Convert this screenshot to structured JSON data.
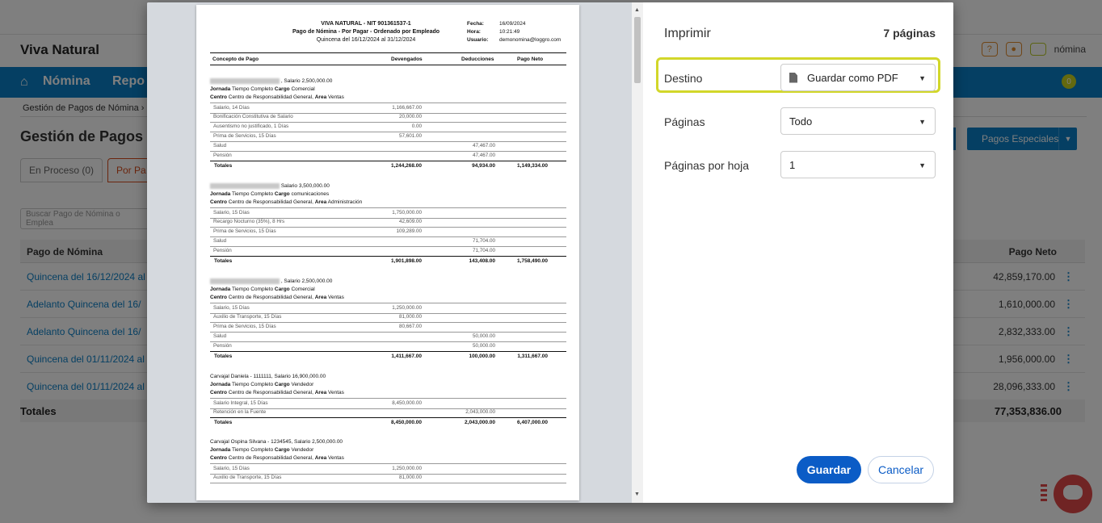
{
  "app": {
    "title": "Viva Natural",
    "user_label": "nómina",
    "help_icon_text": "?",
    "nav": [
      "Nómina",
      "Repo"
    ],
    "nav_badge": "0",
    "breadcrumb": "Gestión de Pagos de Nómina  ›",
    "page_title": "Gestión de Pagos",
    "tabs": [
      "En Proceso (0)",
      "Por Pa"
    ],
    "special_button": "Pagos Especiales",
    "search_placeholder": "Buscar Pago de Nómina o Emplea",
    "table": {
      "col_left": "Pago de Nómina",
      "col_right": "Pago Neto",
      "rows": [
        {
          "name": "Quincena del 16/12/2024 al",
          "amount": "42,859,170.00"
        },
        {
          "name": "Adelanto Quincena del 16/",
          "amount": "1,610,000.00"
        },
        {
          "name": "Adelanto Quincena del 16/",
          "amount": "2,832,333.00"
        },
        {
          "name": "Quincena del 01/11/2024 al",
          "amount": "1,956,000.00"
        },
        {
          "name": "Quincena del 01/11/2024 al",
          "amount": "28,096,333.00"
        }
      ],
      "totals_label": "Totales",
      "totals_amount": "77,353,836.00"
    }
  },
  "dialog": {
    "title": "Imprimir",
    "page_count": "7 páginas",
    "destination_label": "Destino",
    "destination_value": "Guardar como PDF",
    "pages_label": "Páginas",
    "pages_value": "Todo",
    "per_sheet_label": "Páginas por hoja",
    "per_sheet_value": "1",
    "print_button": "Imprimir",
    "print_button_label": "Guardar",
    "cancel_button": "Cancelar",
    "highlight_color": "#d2d72a",
    "accent_color": "#0b5cc6"
  },
  "report": {
    "title1": "VIVA NATURAL - NIT 901361537-1",
    "title2": "Pago de Nómina - Por Pagar - Ordenado por Empleado",
    "title3": "Quincena del 16/12/2024 al 31/12/2024",
    "meta": [
      {
        "label": "Fecha:",
        "value": "16/09/2024"
      },
      {
        "label": "Hora:",
        "value": "10:21:49"
      },
      {
        "label": "Usuario:",
        "value": "demonomina@loggro.com"
      }
    ],
    "columns": [
      "Concepto de Pago",
      "Devengados",
      "Deducciones",
      "Pago Neto"
    ],
    "employees": [
      {
        "head": ", Salario 2,500,000.00",
        "jornada": "Tiempo Completo",
        "cargo": "Comercial",
        "centro": "Centro de Responsabilidad General,",
        "area": "Ventas",
        "lines": [
          {
            "d": "Salario, 14 Días",
            "dev": "1,166,667.00",
            "ded": ""
          },
          {
            "d": "Bonificación Constitutiva de Salario",
            "dev": "20,000.00",
            "ded": ""
          },
          {
            "d": "Ausentismo no justificado, 1 Días",
            "dev": "0.00",
            "ded": ""
          },
          {
            "d": "Prima de Servicios, 15 Días",
            "dev": "57,601.00",
            "ded": ""
          },
          {
            "d": "Salud",
            "dev": "",
            "ded": "47,467.00"
          },
          {
            "d": "Pensión",
            "dev": "",
            "ded": "47,467.00"
          }
        ],
        "tot": {
          "dev": "1,244,268.00",
          "ded": "94,934.00",
          "neto": "1,149,334.00"
        }
      },
      {
        "head": "Salario 3,500,000.00",
        "jornada": "Tiempo Completo",
        "cargo": "comunicaciones",
        "centro": "Centro de Responsabilidad General,",
        "area": "Administración",
        "lines": [
          {
            "d": "Salario, 15 Días",
            "dev": "1,750,000.00",
            "ded": ""
          },
          {
            "d": "Recargo Nocturno (35%), 8 Hrs",
            "dev": "42,609.00",
            "ded": ""
          },
          {
            "d": "Prima de Servicios, 15 Días",
            "dev": "109,289.00",
            "ded": ""
          },
          {
            "d": "Salud",
            "dev": "",
            "ded": "71,704.00"
          },
          {
            "d": "Pensión",
            "dev": "",
            "ded": "71,704.00"
          }
        ],
        "tot": {
          "dev": "1,901,898.00",
          "ded": "143,408.00",
          "neto": "1,758,490.00"
        }
      },
      {
        "head": ", Salario 2,500,000.00",
        "jornada": "Tiempo Completo",
        "cargo": "Comercial",
        "centro": "Centro de Responsabilidad General,",
        "area": "Ventas",
        "lines": [
          {
            "d": "Salario, 15 Días",
            "dev": "1,250,000.00",
            "ded": ""
          },
          {
            "d": "Auxilio de Transporte, 15 Días",
            "dev": "81,000.00",
            "ded": ""
          },
          {
            "d": "Prima de Servicios, 15 Días",
            "dev": "80,667.00",
            "ded": ""
          },
          {
            "d": "Salud",
            "dev": "",
            "ded": "50,000.00"
          },
          {
            "d": "Pensión",
            "dev": "",
            "ded": "50,000.00"
          }
        ],
        "tot": {
          "dev": "1,411,667.00",
          "ded": "100,000.00",
          "neto": "1,311,667.00"
        }
      },
      {
        "head": "Carvajal Daniela - 1111111, Salario 16,900,000.00",
        "jornada": "Tiempo Completo",
        "cargo": "Vendedor",
        "centro": "Centro de Responsabilidad General,",
        "area": "Ventas",
        "lines": [
          {
            "d": "Salario Integral, 15 Días",
            "dev": "8,450,000.00",
            "ded": ""
          },
          {
            "d": "Retención en la Fuente",
            "dev": "",
            "ded": "2,043,000.00"
          }
        ],
        "tot": {
          "dev": "8,450,000.00",
          "ded": "2,043,000.00",
          "neto": "6,407,000.00"
        }
      },
      {
        "head": "Carvajal Ospina Silvana - 1234545, Salario 2,500,000.00",
        "jornada": "Tiempo Completo",
        "cargo": "Vendedor",
        "centro": "Centro de Responsabilidad General,",
        "area": "Ventas",
        "lines": [
          {
            "d": "Salario, 15 Días",
            "dev": "1,250,000.00",
            "ded": ""
          },
          {
            "d": "Auxilio de Transporte, 15 Días",
            "dev": "81,000.00",
            "ded": ""
          }
        ],
        "tot": null
      }
    ],
    "totals_word": "Totales",
    "jornada_word": "Jornada",
    "cargo_word": "Cargo",
    "centro_word": "Centro",
    "area_word": "Area"
  }
}
